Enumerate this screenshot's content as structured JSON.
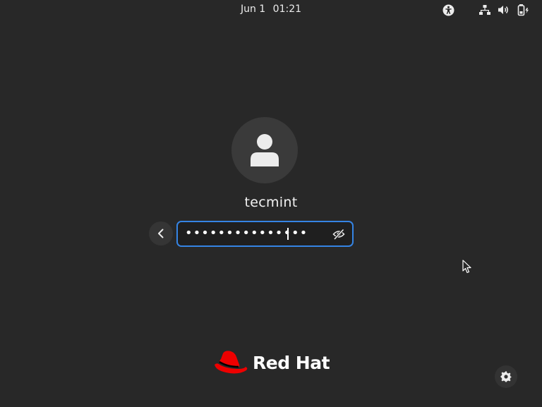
{
  "top_bar": {
    "date": "Jun 1",
    "time": "01:21",
    "icons": [
      "accessibility-icon",
      "network-icon",
      "volume-icon",
      "battery-icon"
    ]
  },
  "login": {
    "avatar_icon": "user-icon",
    "username": "tecmint",
    "back_icon": "chevron-left-icon",
    "password_value": "•••••••••••••••",
    "reveal_icon": "eye-slash-icon"
  },
  "branding": {
    "logo_icon": "red-hat-logo",
    "name": "Red Hat"
  },
  "settings": {
    "icon": "gear-icon"
  },
  "colors": {
    "background": "#282828",
    "focus_accent": "#3584e4",
    "brand_red": "#ee0000"
  }
}
